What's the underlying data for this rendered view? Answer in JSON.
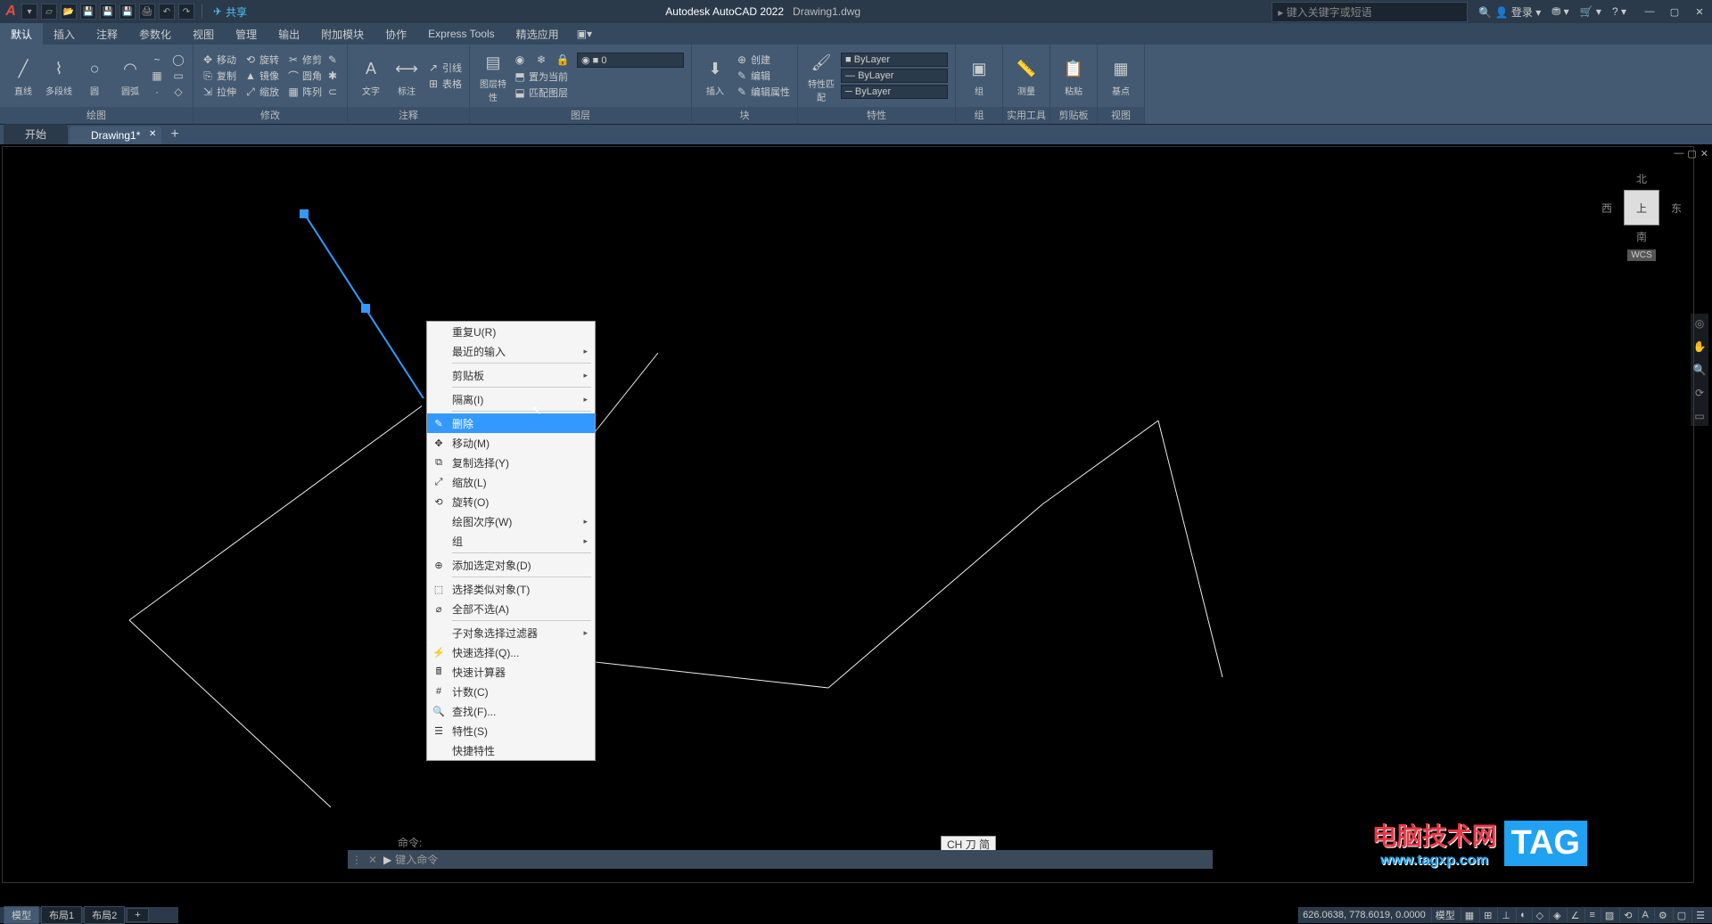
{
  "title": {
    "app": "Autodesk AutoCAD 2022",
    "file": "Drawing1.dwg"
  },
  "share_label": "共享",
  "search_placeholder": "键入关键字或短语",
  "login_label": "登录",
  "menu_tabs": [
    "默认",
    "插入",
    "注释",
    "参数化",
    "视图",
    "管理",
    "输出",
    "附加模块",
    "协作",
    "Express Tools",
    "精选应用"
  ],
  "ribbon": {
    "draw": {
      "title": "绘图",
      "line": "直线",
      "polyline": "多段线",
      "circle": "圆",
      "arc": "圆弧"
    },
    "modify": {
      "title": "修改",
      "move": "移动",
      "copy": "复制",
      "stretch": "拉伸",
      "rotate": "旋转",
      "mirror": "镜像",
      "scale": "缩放",
      "trim": "修剪",
      "fillet": "圆角",
      "array": "阵列"
    },
    "annotate": {
      "title": "注释",
      "text": "文字",
      "dim": "标注",
      "leader": "引线",
      "table": "表格"
    },
    "layer": {
      "title": "图层",
      "props": "图层特性",
      "current": "置为当前",
      "match": "匹配图层"
    },
    "block": {
      "title": "块",
      "insert": "插入",
      "create": "创建",
      "edit": "编辑",
      "editattr": "编辑属性"
    },
    "prop": {
      "title": "特性",
      "match": "特性匹配",
      "bylayer": "ByLayer"
    },
    "group": {
      "title": "组",
      "label": "组"
    },
    "util": {
      "title": "实用工具",
      "label": "测量"
    },
    "clip": {
      "title": "剪贴板",
      "label": "粘贴"
    },
    "view": {
      "title": "视图",
      "label": "基点"
    }
  },
  "file_tabs": {
    "start": "开始",
    "drawing": "Drawing1*"
  },
  "viewcube": {
    "n": "北",
    "s": "南",
    "e": "东",
    "w": "西",
    "top": "上",
    "wcs": "WCS"
  },
  "context_menu": {
    "repeat": "重复U(R)",
    "recent": "最近的输入",
    "clipboard": "剪贴板",
    "isolate": "隔离(I)",
    "delete": "删除",
    "move": "移动(M)",
    "copysel": "复制选择(Y)",
    "scale": "缩放(L)",
    "rotate": "旋转(O)",
    "draworder": "绘图次序(W)",
    "group": "组",
    "addselected": "添加选定对象(D)",
    "selectsim": "选择类似对象(T)",
    "deselect": "全部不选(A)",
    "subfilter": "子对象选择过滤器",
    "quicksel": "快速选择(Q)...",
    "quickcalc": "快速计算器",
    "count": "计数(C)",
    "find": "查找(F)...",
    "props": "特性(S)",
    "quickprops": "快捷特性"
  },
  "cmd": {
    "history": "命令:",
    "placeholder": "键入命令",
    "prefix": "▶"
  },
  "ime": "CH 刀 简",
  "status": {
    "coords": "626.0638, 778.6019, 0.0000",
    "model": "模型"
  },
  "bottom_tabs": [
    "模型",
    "布局1",
    "布局2"
  ],
  "watermark": {
    "cn": "电脑技术网",
    "url": "www.tagxp.com",
    "tag": "TAG"
  }
}
